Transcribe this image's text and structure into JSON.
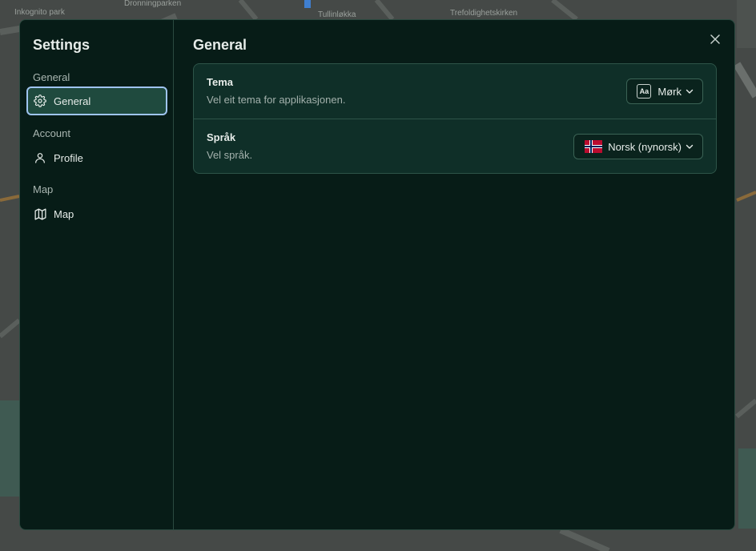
{
  "map": {
    "labels": [
      "Inkognito park",
      "Dronningparken",
      "Tullinløkka",
      "Trefoldighetskirken"
    ]
  },
  "sidebar": {
    "title": "Settings",
    "sections": [
      {
        "label": "General",
        "items": [
          {
            "label": "General",
            "icon": "gear-icon",
            "active": true
          }
        ]
      },
      {
        "label": "Account",
        "items": [
          {
            "label": "Profile",
            "icon": "user-icon",
            "active": false
          }
        ]
      },
      {
        "label": "Map",
        "items": [
          {
            "label": "Map",
            "icon": "map-icon",
            "active": false
          }
        ]
      }
    ]
  },
  "main": {
    "title": "General",
    "close_icon": "close-icon",
    "settings": [
      {
        "title": "Tema",
        "description": "Vel eit tema for applikasjonen.",
        "value": "Mørk",
        "badge": "Aa"
      },
      {
        "title": "Språk",
        "description": "Vel språk.",
        "value": "Norsk (nynorsk)",
        "icon": "norway-flag-icon"
      }
    ]
  },
  "colors": {
    "dialog_bg": "#071c17",
    "card_bg": "#0f2f28",
    "active_item_bg": "#1f4a3e",
    "focus_ring": "#9fc4f0"
  }
}
